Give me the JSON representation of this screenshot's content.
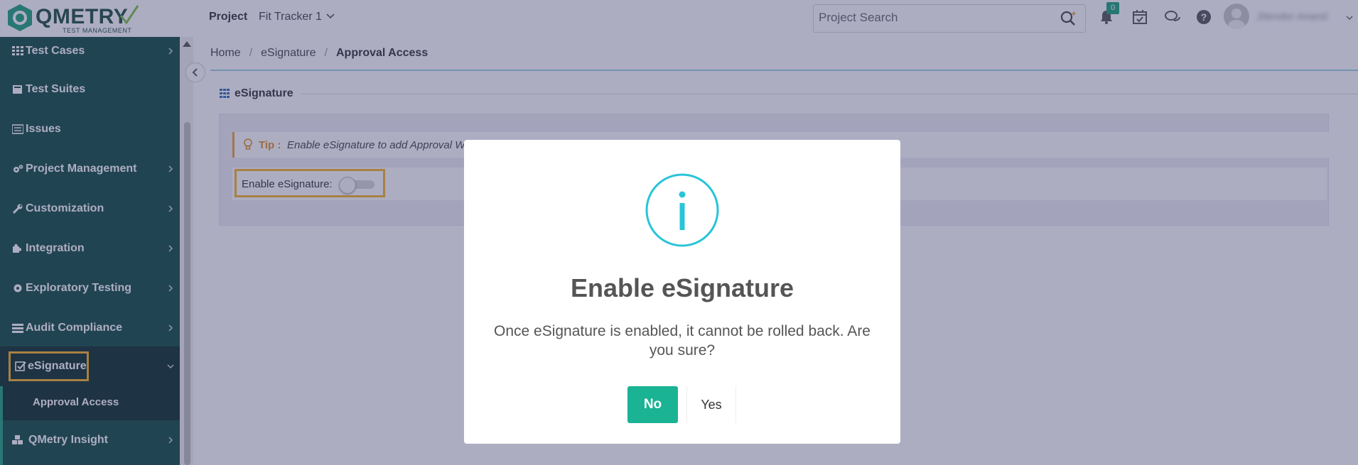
{
  "app": {
    "logo_text": "QMETRY",
    "logo_subtext": "TEST MANAGEMENT"
  },
  "header": {
    "project_label": "Project",
    "project_value": "Fit Tracker 1",
    "search_placeholder": "Project Search",
    "notification_count": "0",
    "user_name": "Jitender Anand"
  },
  "sidebar": {
    "items": [
      {
        "label": "Test Cases",
        "icon": "grid-icon"
      },
      {
        "label": "Test Suites",
        "icon": "suite-icon"
      },
      {
        "label": "Issues",
        "icon": "issues-icon"
      },
      {
        "label": "Project Management",
        "icon": "gears-icon"
      },
      {
        "label": "Customization",
        "icon": "wrench-icon"
      },
      {
        "label": "Integration",
        "icon": "puzzle-icon"
      },
      {
        "label": "Exploratory Testing",
        "icon": "gear-icon"
      },
      {
        "label": "Audit Compliance",
        "icon": "audit-icon"
      },
      {
        "label": "eSignature",
        "icon": "check-square-icon"
      },
      {
        "label": "QMetry Insight",
        "icon": "cubes-icon"
      }
    ],
    "subitem": "Approval Access"
  },
  "breadcrumb": {
    "home": "Home",
    "parent": "eSignature",
    "current": "Approval Access"
  },
  "section": {
    "title": "eSignature",
    "tip_label": "Tip :",
    "tip_text": "Enable eSignature to add Approval Workflow",
    "enable_label": "Enable eSignature:",
    "enabled": false
  },
  "modal": {
    "title": "Enable eSignature",
    "message": "Once eSignature is enabled, it cannot be rolled back. Are you sure?",
    "no_label": "No",
    "yes_label": "Yes",
    "icon": "info-icon"
  },
  "colors": {
    "sidebar_bg": "#0f4a3f",
    "accent_green": "#1ab394",
    "highlight_orange": "#f5b324",
    "info_cyan": "#29c4d9"
  }
}
